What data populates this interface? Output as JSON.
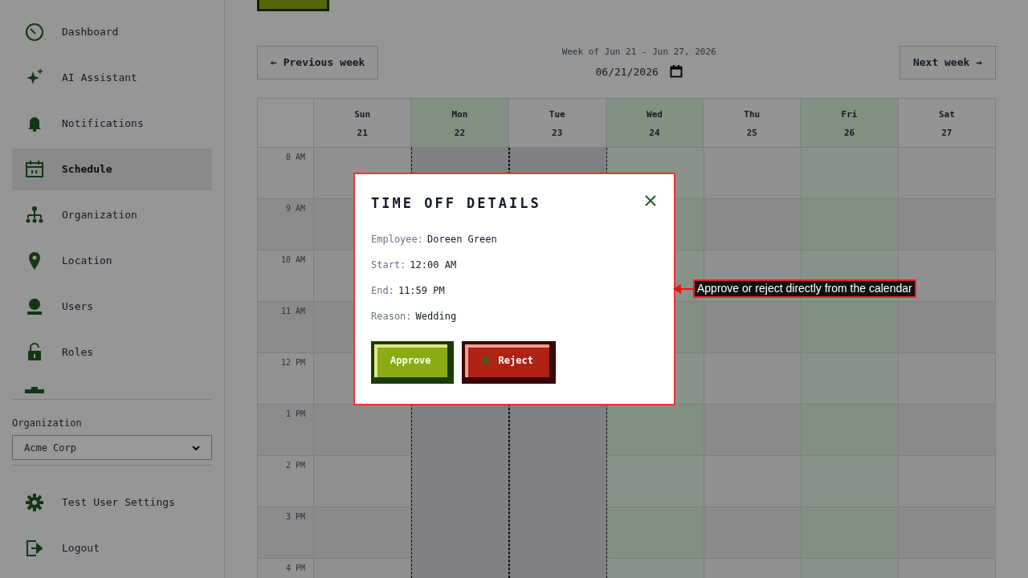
{
  "sidebar": {
    "items": [
      {
        "label": "Dashboard",
        "selected": false
      },
      {
        "label": "AI Assistant",
        "selected": false
      },
      {
        "label": "Notifications",
        "selected": false
      },
      {
        "label": "Schedule",
        "selected": true
      },
      {
        "label": "Organization",
        "selected": false
      },
      {
        "label": "Location",
        "selected": false
      },
      {
        "label": "Users",
        "selected": false
      },
      {
        "label": "Roles",
        "selected": false
      }
    ],
    "organization": {
      "label": "Organization",
      "value": "Acme Corp"
    },
    "footer_items": [
      {
        "label": "Test User Settings"
      },
      {
        "label": "Logout"
      }
    ]
  },
  "week_nav": {
    "previous": "← Previous week",
    "range": "Week of Jun 21 - Jun 27, 2026",
    "date": "06/21/2026",
    "next": "Next week →"
  },
  "calendar": {
    "days": [
      {
        "name": "Sun",
        "date": "21",
        "available": false,
        "time_off": false
      },
      {
        "name": "Mon",
        "date": "22",
        "available": true,
        "time_off": true
      },
      {
        "name": "Tue",
        "date": "23",
        "available": false,
        "time_off": true
      },
      {
        "name": "Wed",
        "date": "24",
        "available": true,
        "time_off": false
      },
      {
        "name": "Thu",
        "date": "25",
        "available": false,
        "time_off": false
      },
      {
        "name": "Fri",
        "date": "26",
        "available": true,
        "time_off": false
      },
      {
        "name": "Sat",
        "date": "27",
        "available": false,
        "time_off": false
      }
    ],
    "hours": [
      "8 AM",
      "9 AM",
      "10 AM",
      "11 AM",
      "12 PM",
      "1 PM",
      "2 PM",
      "3 PM",
      "4 PM"
    ]
  },
  "modal": {
    "title": "TIME OFF DETAILS",
    "fields": [
      {
        "label": "Employee:",
        "value": "Doreen Green"
      },
      {
        "label": "Start:",
        "value": "12:00 AM"
      },
      {
        "label": "End:",
        "value": "11:59 PM"
      },
      {
        "label": "Reason:",
        "value": "Wedding"
      }
    ],
    "buttons": [
      {
        "kind": "approve",
        "label": "Approve"
      },
      {
        "kind": "reject",
        "label": "Reject"
      }
    ]
  },
  "annotation": {
    "text": "Approve or reject directly from the calendar"
  }
}
